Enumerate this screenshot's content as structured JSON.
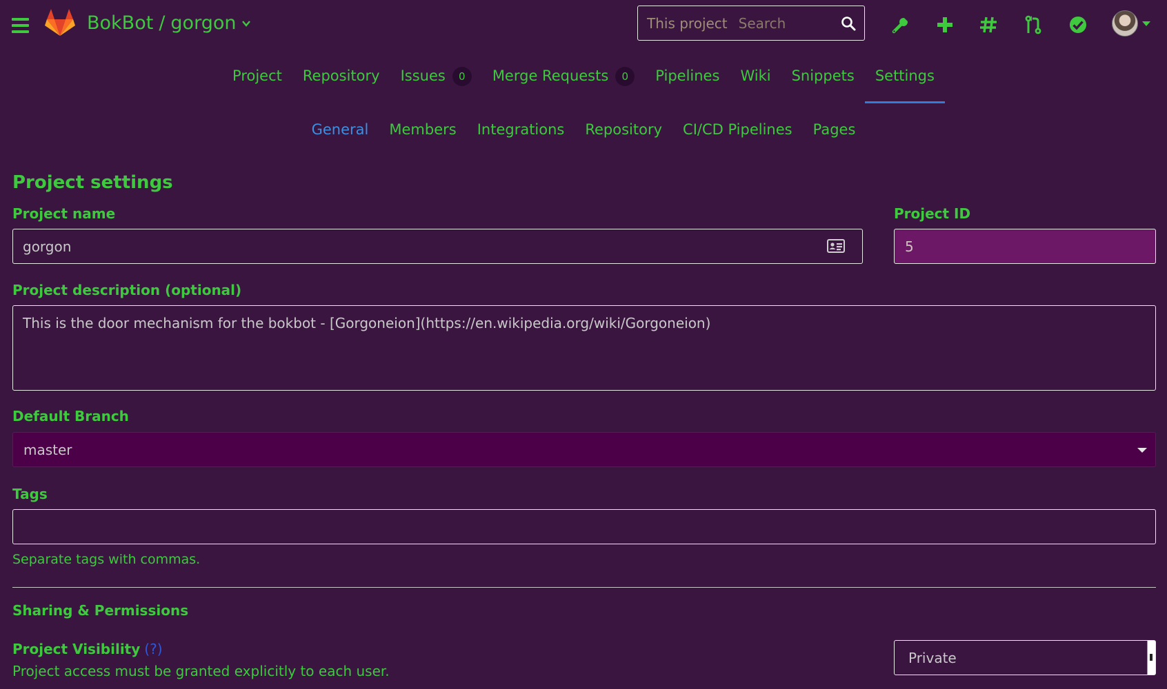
{
  "header": {
    "group": "BokBot",
    "separator": "/",
    "project": "gorgon",
    "search": {
      "scope": "This project",
      "placeholder": "Search"
    },
    "icons": [
      "wrench-icon",
      "plus-icon",
      "hash-icon",
      "merge-request-icon",
      "check-circle-icon"
    ]
  },
  "main_nav": {
    "items": [
      {
        "label": "Project"
      },
      {
        "label": "Repository"
      },
      {
        "label": "Issues",
        "count": "0"
      },
      {
        "label": "Merge Requests",
        "count": "0"
      },
      {
        "label": "Pipelines"
      },
      {
        "label": "Wiki"
      },
      {
        "label": "Snippets"
      },
      {
        "label": "Settings",
        "active": true
      }
    ]
  },
  "sub_nav": {
    "items": [
      {
        "label": "General",
        "active": true
      },
      {
        "label": "Members"
      },
      {
        "label": "Integrations"
      },
      {
        "label": "Repository"
      },
      {
        "label": "CI/CD Pipelines"
      },
      {
        "label": "Pages"
      }
    ]
  },
  "form": {
    "title": "Project settings",
    "project_name": {
      "label": "Project name",
      "value": "gorgon"
    },
    "project_id": {
      "label": "Project ID",
      "value": "5"
    },
    "description": {
      "label": "Project description (optional)",
      "value": "This is the door mechanism for the bokbot - [Gorgoneion](https://en.wikipedia.org/wiki/Gorgoneion)"
    },
    "default_branch": {
      "label": "Default Branch",
      "value": "master"
    },
    "tags": {
      "label": "Tags",
      "value": "",
      "help": "Separate tags with commas."
    },
    "sharing": {
      "title": "Sharing & Permissions",
      "visibility_label": "Project Visibility",
      "visibility_help_link": "(?)",
      "visibility_help": "Project access must be granted explicitly to each user.",
      "visibility_value": "Private"
    }
  },
  "colors": {
    "background": "#3a1540",
    "text": "#3ec93e",
    "active_subnav": "#3d8fe0",
    "active_underline": "#2e7ed6",
    "project_id_bg": "#6d1866",
    "branch_bg": "#4c0048"
  }
}
